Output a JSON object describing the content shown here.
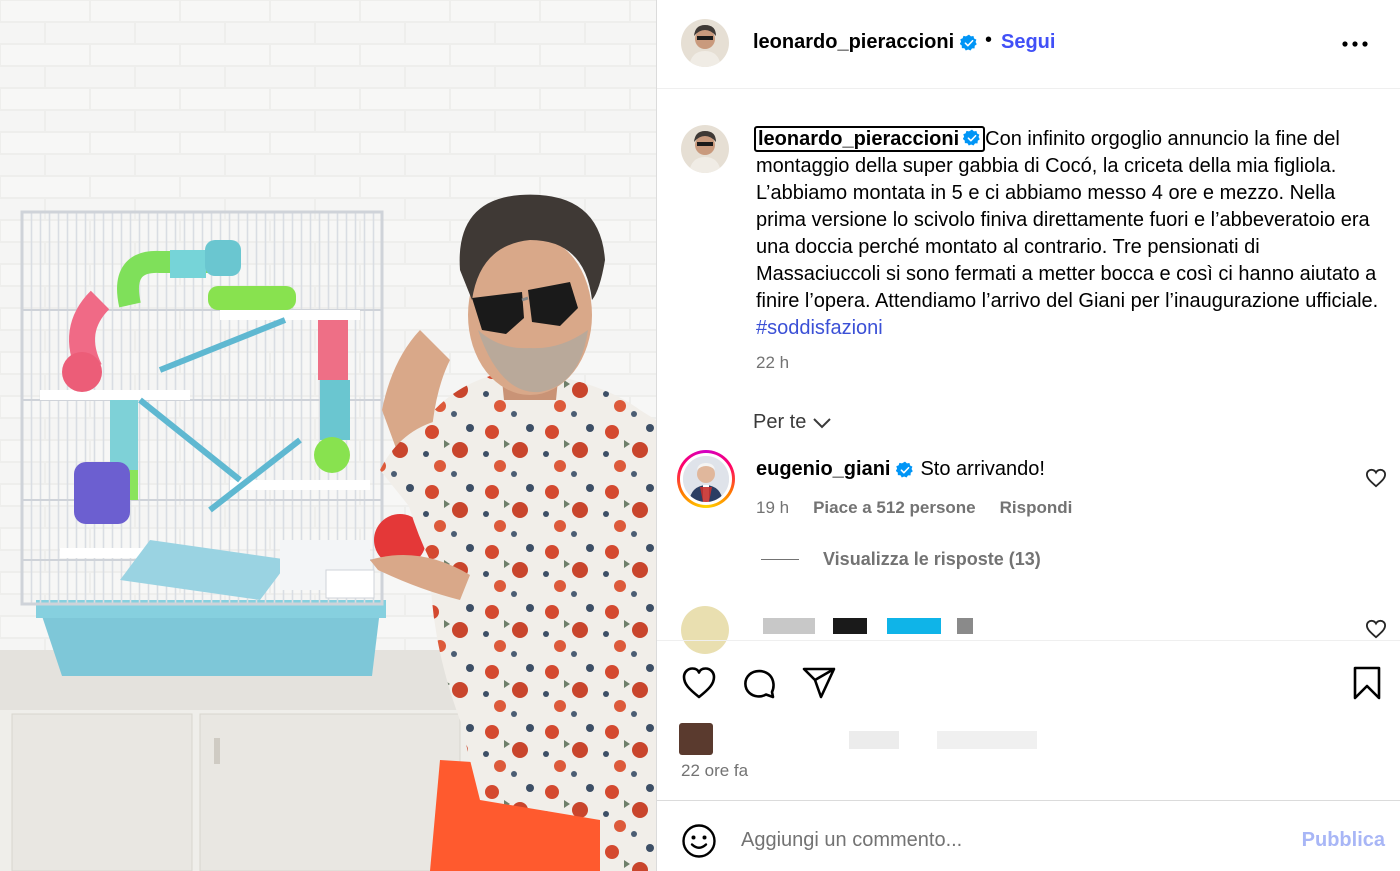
{
  "post": {
    "username": "leonardo_pieraccioni",
    "verified_icon": "verified-badge-icon",
    "separator": "•",
    "follow_label": "Segui",
    "more_icon": "more-options-icon"
  },
  "caption": {
    "username": "leonardo_pieraccioni",
    "text": "Con infinito orgoglio annuncio la fine del montaggio della super gabbia di Cocó, la criceta della mia figliola. L’abbiamo montata in 5 e ci abbiamo messo 4 ore e mezzo. Nella prima versione lo scivolo finiva direttamente fuori e l’abbeveratoio era una doccia perché montato al contrario. Tre pensionati di Massaciuccoli si sono fermati a metter bocca e così ci hanno aiutato a finire l’opera. Attendiamo l’arrivo del Giani per l’inaugurazione ufficiale.",
    "hashtag": "#soddisfazioni",
    "time": "22 h"
  },
  "comments_filter": {
    "label": "Per te"
  },
  "comments": [
    {
      "username": "eugenio_giani",
      "text": "Sto arrivando!",
      "time": "19 h",
      "likes": "Piace a 512 persone",
      "reply_label": "Rispondi",
      "view_replies": "Visualizza le risposte (13)"
    }
  ],
  "actions": {
    "like_icon": "heart-icon",
    "comment_icon": "comment-icon",
    "share_icon": "share-icon",
    "save_icon": "bookmark-icon",
    "time_ago": "22 ore fa"
  },
  "composer": {
    "placeholder": "Aggiungi un commento...",
    "publish_label": "Pubblica"
  },
  "colors": {
    "follow_blue": "#4150f7",
    "hashtag_blue": "#3b50d6",
    "publish_disabled": "#a8b6f6",
    "verified_blue": "#0095f6",
    "secondary_text": "#737373"
  }
}
